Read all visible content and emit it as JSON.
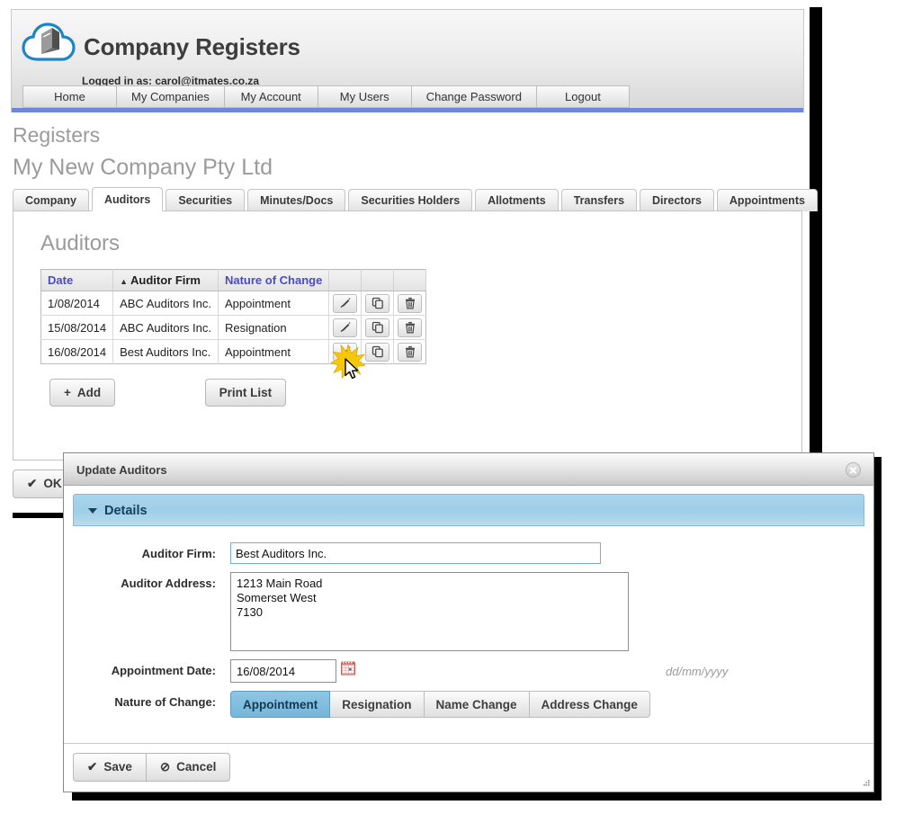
{
  "header": {
    "logo_icon": "cloud-book-logo",
    "app_title": "Company Registers",
    "logged_in_text": "Logged in as: carol@itmates.co.za",
    "nav": [
      {
        "label": "Home"
      },
      {
        "label": "My Companies"
      },
      {
        "label": "My Account"
      },
      {
        "label": "My Users"
      },
      {
        "label": "Change Password"
      },
      {
        "label": "Logout"
      }
    ],
    "accent_rule_color": "#6f86e0"
  },
  "page": {
    "breadcrumb": "Registers",
    "company_name": "My New Company Pty Ltd"
  },
  "tabs": [
    {
      "label": "Company",
      "active": false
    },
    {
      "label": "Auditors",
      "active": true
    },
    {
      "label": "Securities",
      "active": false
    },
    {
      "label": "Minutes/Docs",
      "active": false
    },
    {
      "label": "Securities Holders",
      "active": false
    },
    {
      "label": "Allotments",
      "active": false
    },
    {
      "label": "Transfers",
      "active": false
    },
    {
      "label": "Directors",
      "active": false
    },
    {
      "label": "Appointments",
      "active": false
    }
  ],
  "panel": {
    "title": "Auditors",
    "grid": {
      "columns": [
        {
          "label": "Date",
          "sorted": false,
          "sort_caret": ""
        },
        {
          "label": "Auditor Firm",
          "sorted": true,
          "sort_caret": "▲"
        },
        {
          "label": "Nature of Change",
          "sorted": false,
          "sort_caret": ""
        }
      ],
      "header_link_color": "#4b4bc8",
      "rows": [
        {
          "date": "1/08/2014",
          "firm": "ABC Auditors Inc.",
          "nature": "Appointment"
        },
        {
          "date": "15/08/2014",
          "firm": "ABC Auditors Inc.",
          "nature": "Resignation"
        },
        {
          "date": "16/08/2014",
          "firm": "Best Auditors Inc.",
          "nature": "Appointment"
        }
      ],
      "row_actions": [
        {
          "icon": "edit-pencil-icon"
        },
        {
          "icon": "copy-icon"
        },
        {
          "icon": "trash-icon"
        }
      ]
    },
    "add_button": {
      "glyph": "+",
      "label": "Add"
    },
    "print_button": {
      "label": "Print List"
    },
    "ok_button": {
      "glyph": "✔",
      "label": "OK"
    }
  },
  "dialog": {
    "title": "Update Auditors",
    "close_icon": "close-icon",
    "section": {
      "label": "Details",
      "collapse_icon": "chevron-down-icon"
    },
    "fields": {
      "auditor_firm": {
        "label": "Auditor Firm:",
        "value": "Best Auditors Inc.",
        "placeholder": ""
      },
      "auditor_address": {
        "label": "Auditor Address:",
        "value": "1213 Main Road\nSomerset West\n7130",
        "placeholder": ""
      },
      "appointment_date": {
        "label": "Appointment Date:",
        "value": "16/08/2014",
        "placeholder": "",
        "calendar_icon": "calendar-icon",
        "hint": "dd/mm/yyyy"
      },
      "nature_of_change": {
        "label": "Nature of Change:",
        "selected": "Appointment",
        "options": [
          "Appointment",
          "Resignation",
          "Name Change",
          "Address Change"
        ],
        "selected_color": "#76b6da"
      }
    },
    "footer": {
      "save": {
        "glyph": "✔",
        "label": "Save"
      },
      "cancel": {
        "glyph": "⊘",
        "label": "Cancel"
      }
    },
    "resize_grip_icon": "resize-grip-icon"
  },
  "pointer": {
    "cursor_icon": "mouse-cursor",
    "click_burst_icon": "click-burst",
    "burst_color": "#f7c808"
  }
}
